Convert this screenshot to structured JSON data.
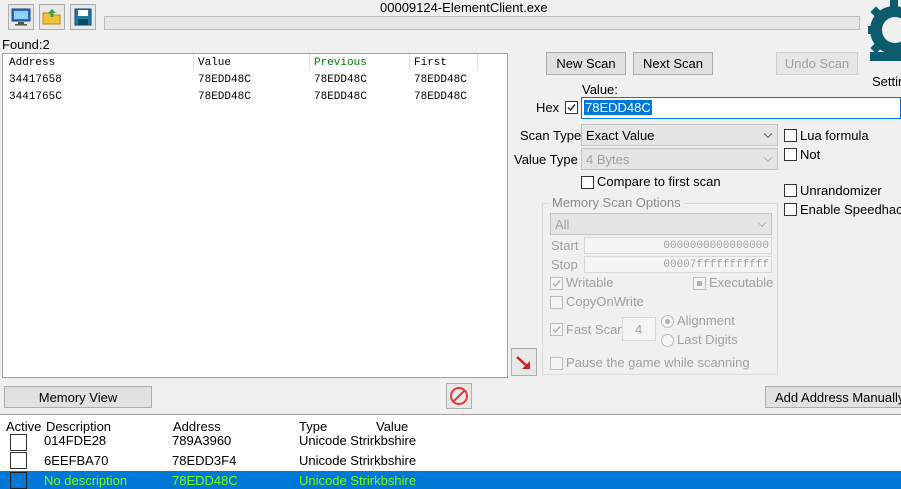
{
  "window": {
    "title": "00009124-ElementClient.exe"
  },
  "found": {
    "label": "Found:",
    "count": "2"
  },
  "results": {
    "columns": [
      "Address",
      "Value",
      "Previous",
      "First"
    ],
    "rows": [
      [
        "34417658",
        "78EDD48C",
        "78EDD48C",
        "78EDD48C"
      ],
      [
        "3441765C",
        "78EDD48C",
        "78EDD48C",
        "78EDD48C"
      ]
    ]
  },
  "buttons": {
    "new_scan": "New Scan",
    "next_scan": "Next Scan",
    "undo_scan": "Undo Scan",
    "memory_view": "Memory View",
    "add_address": "Add Address Manually"
  },
  "settings_label": "Settin",
  "value_section": {
    "label": "Value:",
    "hex_label": "Hex",
    "value": "78EDD48C"
  },
  "scan_type": {
    "label": "Scan Type",
    "selected": "Exact Value"
  },
  "value_type": {
    "label": "Value Type",
    "selected": "4 Bytes"
  },
  "options": {
    "lua_formula": "Lua formula",
    "not": "Not",
    "compare_first": "Compare to first scan",
    "unrandomizer": "Unrandomizer",
    "speedhack": "Enable Speedhack"
  },
  "memory_scan": {
    "title": "Memory Scan Options",
    "region": "All",
    "start_label": "Start",
    "start_value": "0000000000000000",
    "stop_label": "Stop",
    "stop_value": "00007fffffffffff",
    "writable": "Writable",
    "executable": "Executable",
    "copy_on_write": "CopyOnWrite",
    "fast_scan": "Fast Scan",
    "fast_scan_value": "4",
    "alignment": "Alignment",
    "last_digits": "Last Digits",
    "pause_game": "Pause the game while scanning"
  },
  "address_list": {
    "columns": [
      "Active",
      "Description",
      "Address",
      "Type",
      "Value"
    ],
    "rows": [
      {
        "description": "014FDE28",
        "address": "789A3960",
        "type": "Unicode Strirkbshire",
        "selected": false
      },
      {
        "description": "6EEFBA70",
        "address": "78EDD3F4",
        "type": "Unicode Strirkbshire",
        "selected": false
      },
      {
        "description": "No description",
        "address": "78EDD48C",
        "type": "Unicode Strirkbshire",
        "selected": true
      }
    ]
  },
  "colors": {
    "selection": "#0078d7",
    "selected_text": "#7cfc00",
    "previous_header": "#008000",
    "logo": "#0d5b6e",
    "stop_icon": "#e23c3c"
  }
}
